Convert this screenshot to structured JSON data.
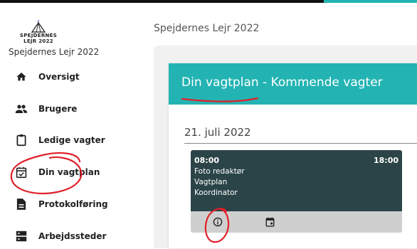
{
  "logo": {
    "line1": "SPEJDERNES",
    "line2": "LEJR 2022"
  },
  "app_name": "Spejdernes Lejr 2022",
  "header": {
    "title": "Spejdernes Lejr 2022"
  },
  "sidebar": {
    "items": [
      {
        "label": "Oversigt",
        "icon": "home-icon"
      },
      {
        "label": "Brugere",
        "icon": "users-icon"
      },
      {
        "label": "Ledige vagter",
        "icon": "clipboard-icon"
      },
      {
        "label": "Din vagtplan",
        "icon": "calendar-check-icon"
      },
      {
        "label": "Protokolføring",
        "icon": "document-icon"
      },
      {
        "label": "Arbejdssteder",
        "icon": "dns-icon"
      }
    ]
  },
  "card": {
    "title": "Din vagtplan - Kommende vagter",
    "date": "21. juli 2022",
    "shift": {
      "start": "08:00",
      "end": "18:00",
      "lines": [
        "Foto redaktør",
        "Vagtplan",
        "Koordinator"
      ],
      "actions": [
        "info-icon",
        "calendar-icon"
      ]
    }
  },
  "colors": {
    "accent": "#23b3b3",
    "shift_bg": "#2b4448",
    "annotation": "#e0202a"
  }
}
